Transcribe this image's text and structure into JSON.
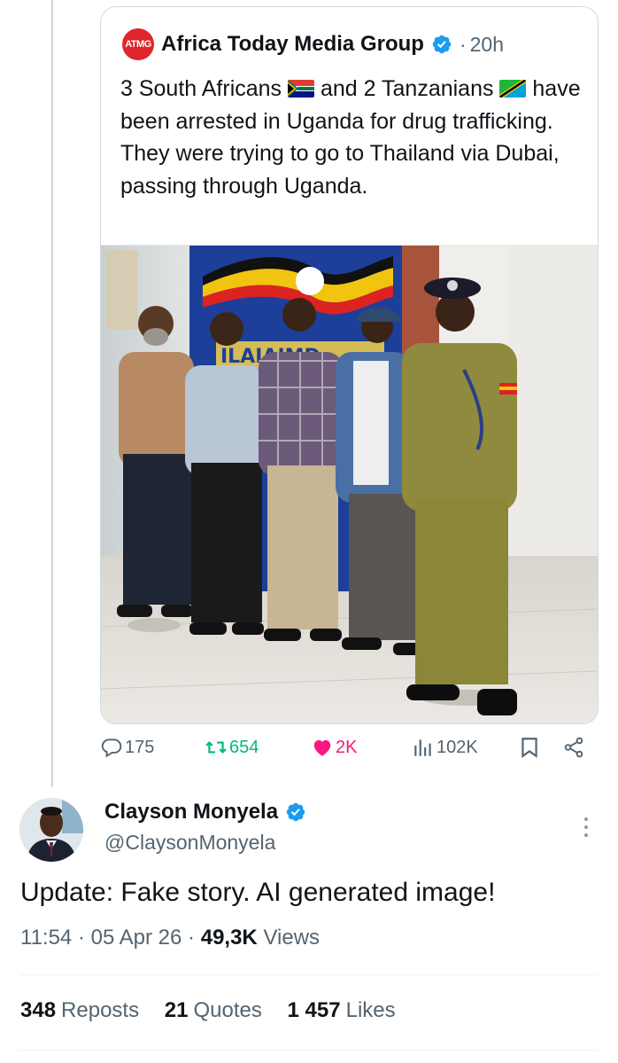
{
  "quoted_tweet": {
    "logo_text": "ATMG",
    "author_name": "Africa Today Media Group",
    "dot": "·",
    "time": "20h",
    "text_part1": "3 South Africans ",
    "text_part2": " and 2 Tanzanians ",
    "text_part3": " have been arrested in Uganda for drug trafficking. They were trying to go to Thailand via Dubai, passing through Uganda.",
    "banner_text": "ILAIAIMD",
    "actions": {
      "replies": "175",
      "reposts": "654",
      "likes": "2K",
      "views": "102K"
    }
  },
  "main_tweet": {
    "author_name": "Clayson Monyela",
    "handle": "@ClaysonMonyela",
    "text": "Update: Fake story. AI generated image!",
    "time": "11:54",
    "sep1": "·",
    "date": "05 Apr 26",
    "sep2": "·",
    "views_count": "49,3K",
    "views_label": "Views",
    "reposts_count": "348",
    "reposts_label": "Reposts",
    "quotes_count": "21",
    "quotes_label": "Quotes",
    "likes_count": "1 457",
    "likes_label": "Likes"
  },
  "colors": {
    "verified": "#1d9bf0",
    "repost_active": "#00ba7c",
    "like_active": "#f91880",
    "secondary_text": "#536471",
    "atmg_red": "#e0262b"
  },
  "icons": [
    "verified-badge-icon",
    "reply-icon",
    "repost-icon",
    "like-icon",
    "views-icon",
    "bookmark-icon",
    "share-icon",
    "more-icon",
    "south-africa-flag-icon",
    "tanzania-flag-icon"
  ]
}
